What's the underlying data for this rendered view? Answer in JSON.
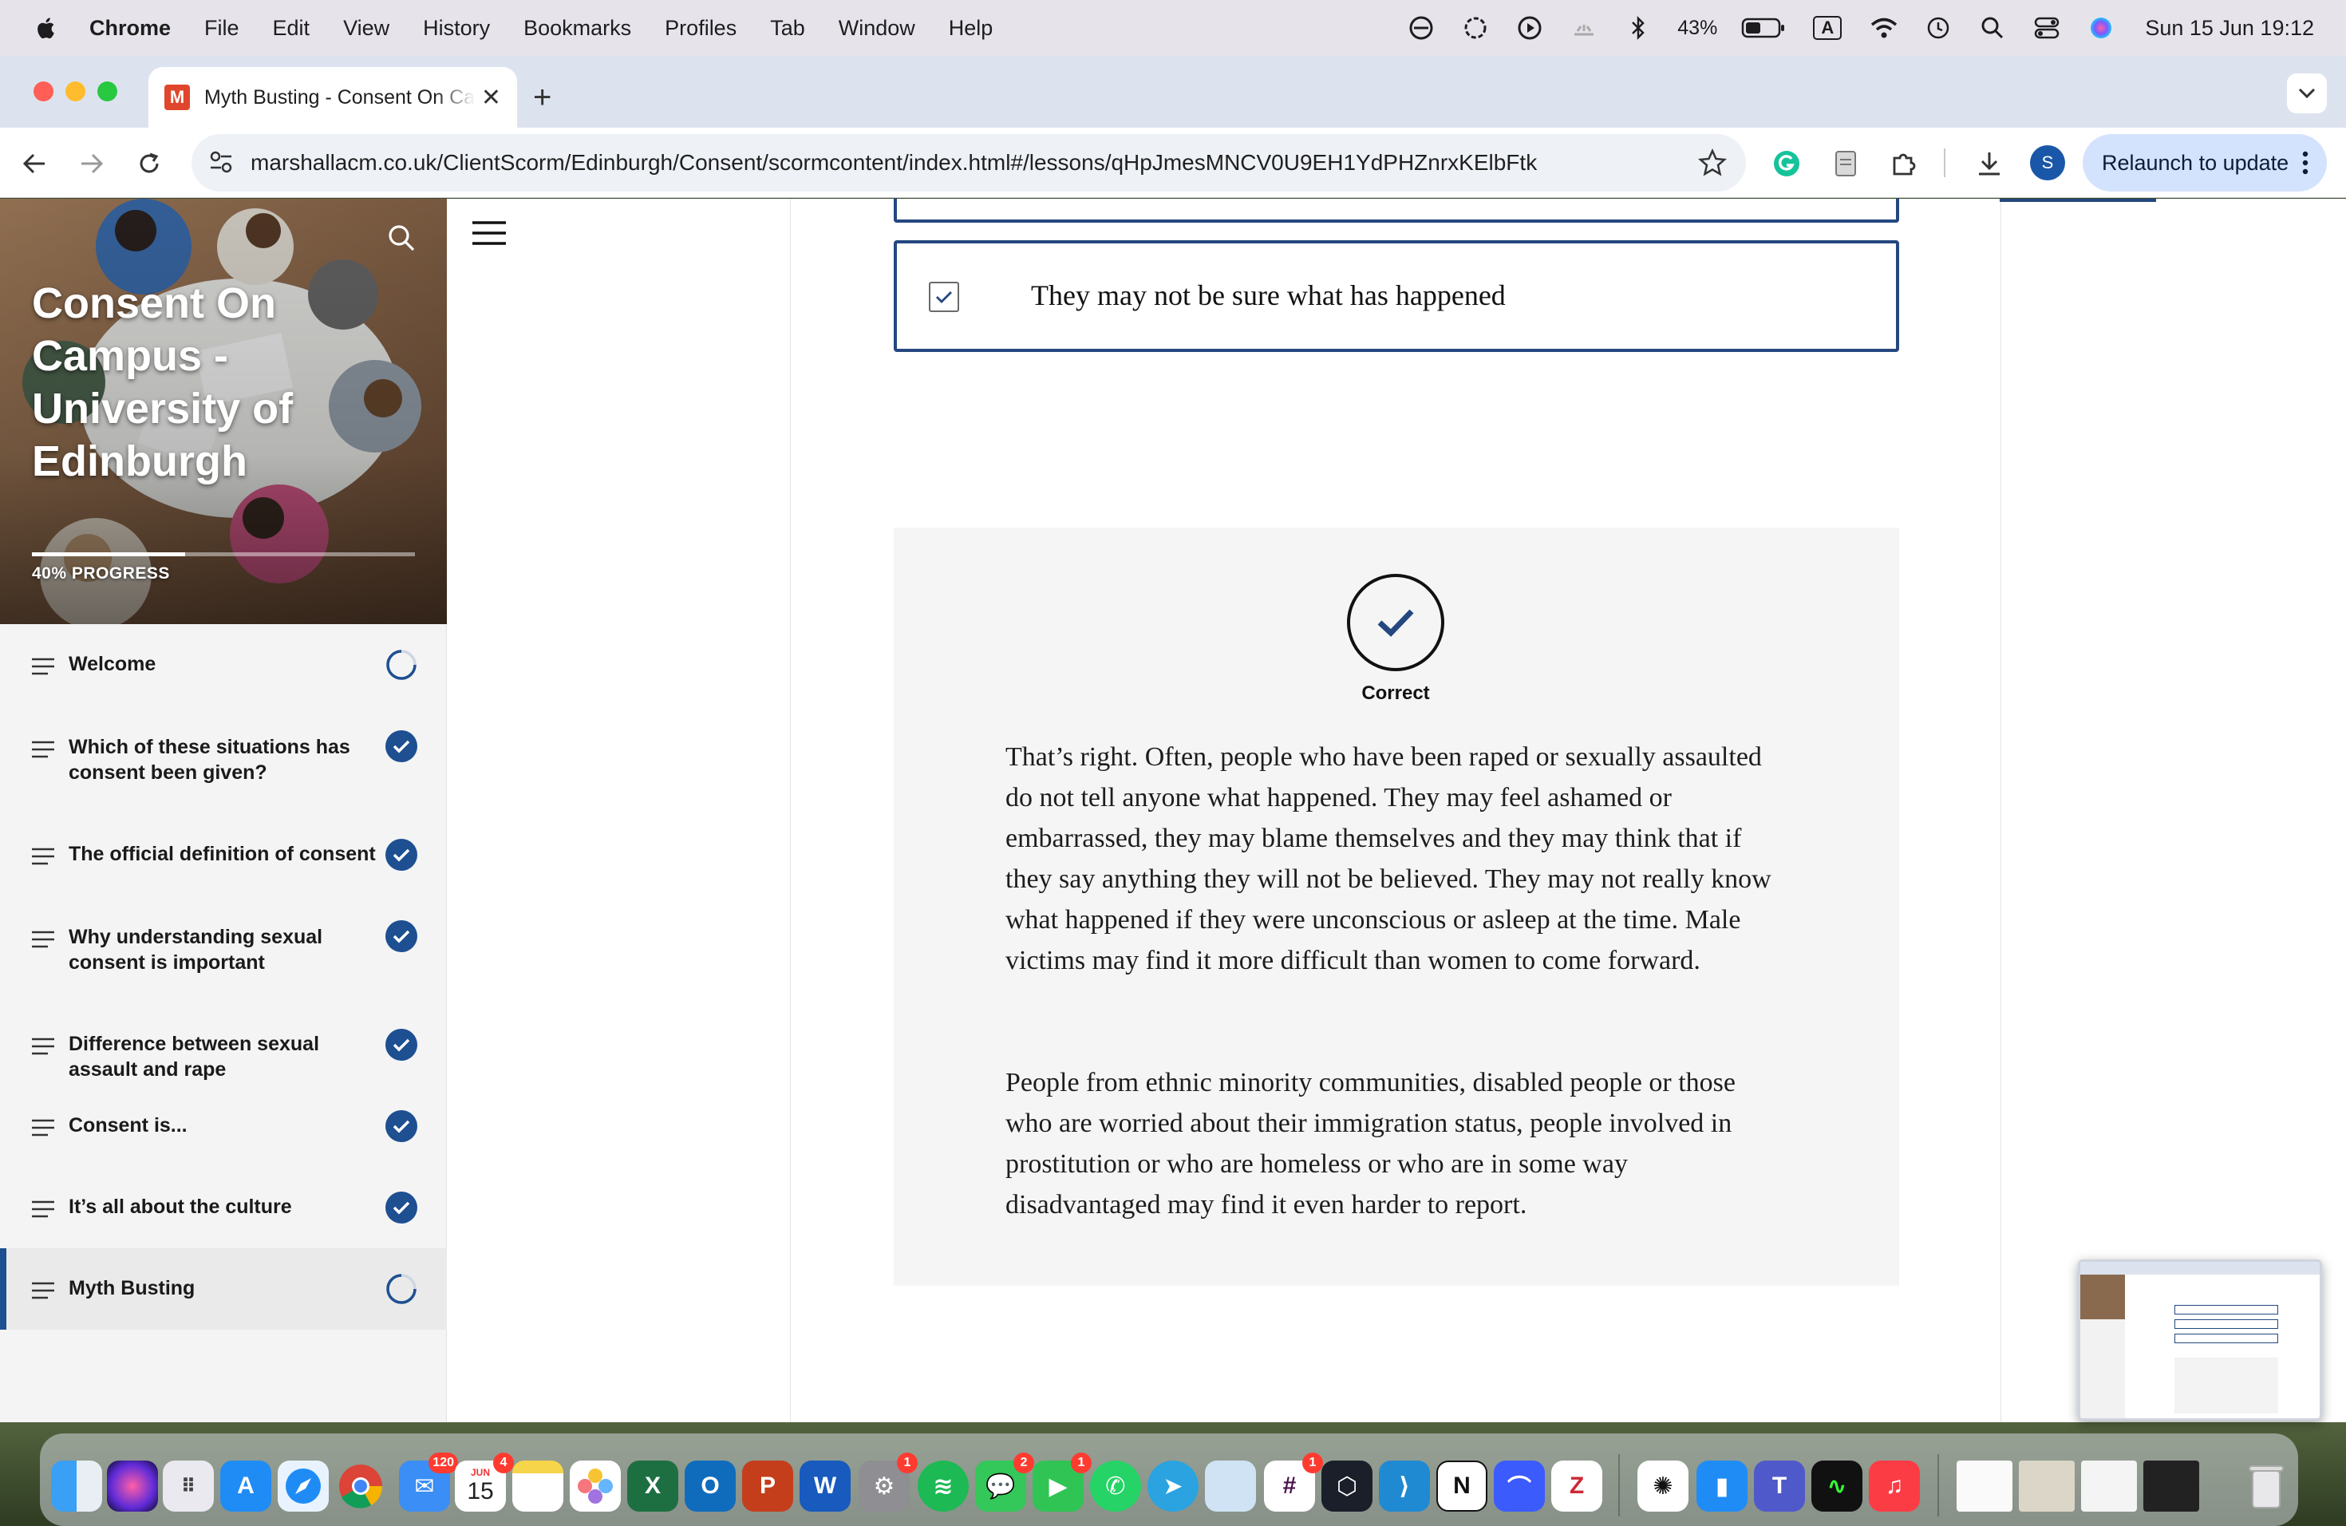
{
  "menubar": {
    "app_name": "Chrome",
    "items": [
      "File",
      "Edit",
      "View",
      "History",
      "Bookmarks",
      "Profiles",
      "Tab",
      "Window",
      "Help"
    ],
    "battery": "43%",
    "input_source": "A",
    "clock": "Sun 15 Jun  19:12"
  },
  "browser": {
    "tab_title": "Myth Busting - Consent On Campus - University of Edinburgh",
    "tab_favicon_letter": "M",
    "url": "marshallacm.co.uk/ClientScorm/Edinburgh/Consent/scormcontent/index.html#/lessons/qHpJmesMNCV0U9EH1YdPHZnrxKElbFtk",
    "profile_initial": "S",
    "relaunch_label": "Relaunch to update"
  },
  "course": {
    "title": "Consent On Campus - University of Edinburgh",
    "progress_value": 0.4,
    "progress_label": "40% PROGRESS",
    "lessons": [
      {
        "label": "Welcome",
        "status": "in-progress"
      },
      {
        "label": "Which of these situations has consent been given?",
        "status": "complete"
      },
      {
        "label": "The official definition of consent",
        "status": "complete"
      },
      {
        "label": "Why understanding sexual consent is important",
        "status": "complete"
      },
      {
        "label": "Difference between sexual assault and rape",
        "status": "complete"
      },
      {
        "label": "Consent is...",
        "status": "complete"
      },
      {
        "label": "It’s all about the culture",
        "status": "complete"
      },
      {
        "label": "Myth Busting",
        "status": "in-progress",
        "active": true
      }
    ]
  },
  "quiz": {
    "answer_text": "They may not be sure what has happened",
    "answer_checked": true,
    "feedback_label": "Correct",
    "feedback_para_1": "That’s right. Often, people who have been raped or sexually assaulted do not tell anyone what happened. They may feel ashamed or embarrassed, they may blame themselves and they may think that if they say anything they will not be believed. They may not really know what happened if they were unconscious or asleep at the time. Male victims may find it more difficult than women to come forward.",
    "feedback_para_2": "People from ethnic minority communities, disabled people or those who are worried about their immigration status, people involved in prostitution or who are homeless or who are in some way disadvantaged may find it even harder to report."
  },
  "dock": {
    "calendar_month": "JUN",
    "calendar_day": "15",
    "mail_badge": "120",
    "calendar_badge": "4",
    "settings_badge": "1",
    "messages_badge": "2",
    "facetime_badge": "1",
    "slack_badge": "1"
  },
  "colors": {
    "accent": "#24477f",
    "status_complete": "#1d4f91",
    "relaunch_bg": "#d3e3fd"
  }
}
